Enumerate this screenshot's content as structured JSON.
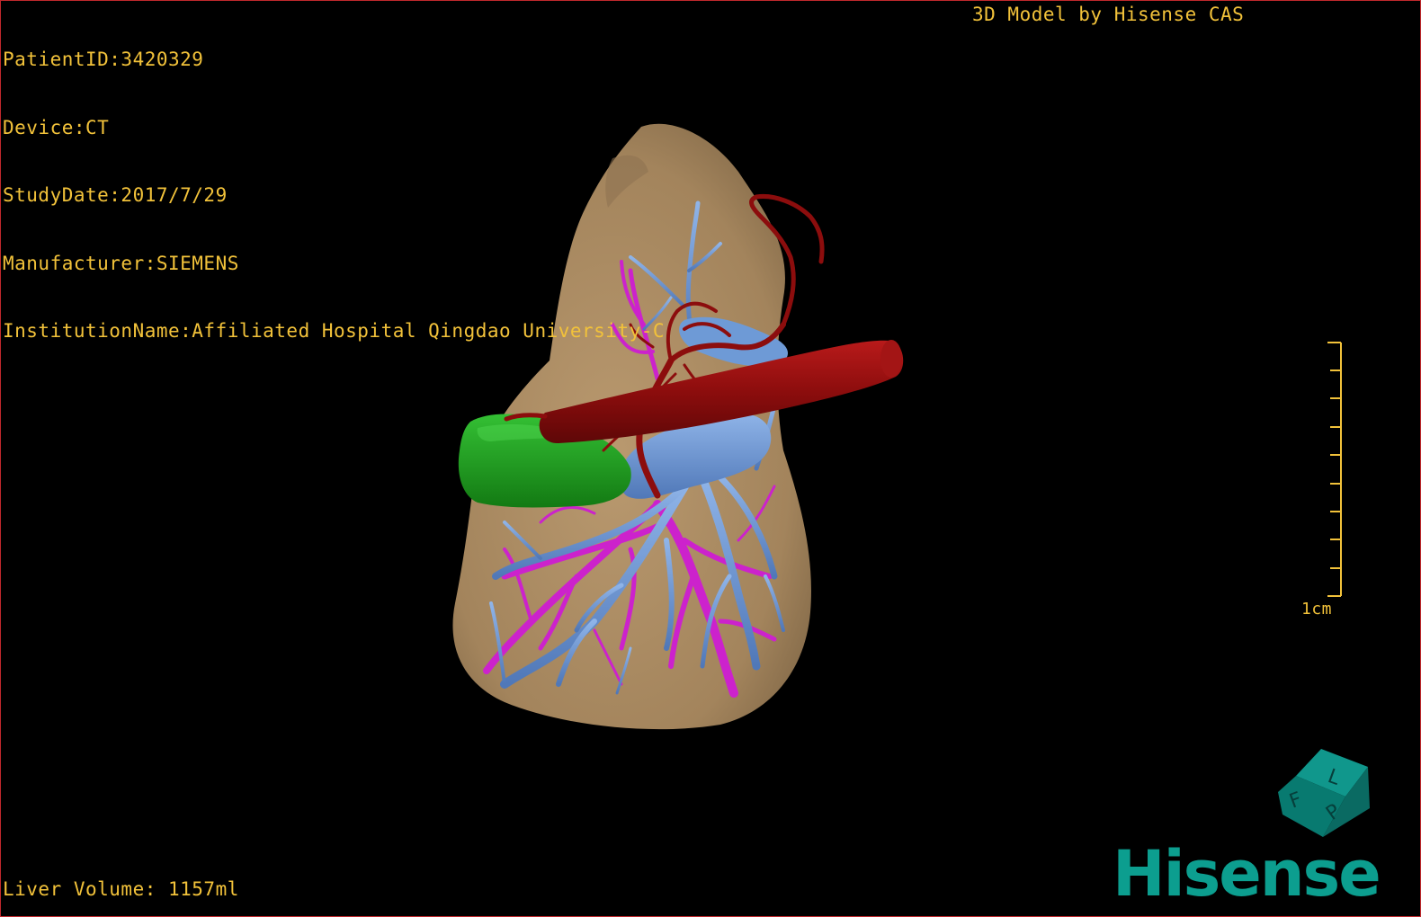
{
  "viewer": {
    "info_lines": [
      "PatientID:3420329",
      "Device:CT",
      "StudyDate:2017/7/29",
      "Manufacturer:SIEMENS",
      "InstitutionName:Affiliated Hospital Qingdao University-C"
    ],
    "model_credit": "3D Model by Hisense CAS",
    "liver_volume": "Liver Volume: 1157ml",
    "scale_label": "1cm",
    "logo_text": "Hisense",
    "orientation_cube": {
      "face_letters": [
        "F",
        "L",
        "P"
      ]
    }
  },
  "colors": {
    "overlay_text": "#f2c23a",
    "liver": "#a98a64",
    "artery": "#8c0d0d",
    "portal_vein": "#6e9ad6",
    "hepatic_vein": "#cc22cc",
    "gallbladder": "#1e9e1e",
    "brand": "#0c9e8f",
    "frame_border": "#c0282c"
  }
}
